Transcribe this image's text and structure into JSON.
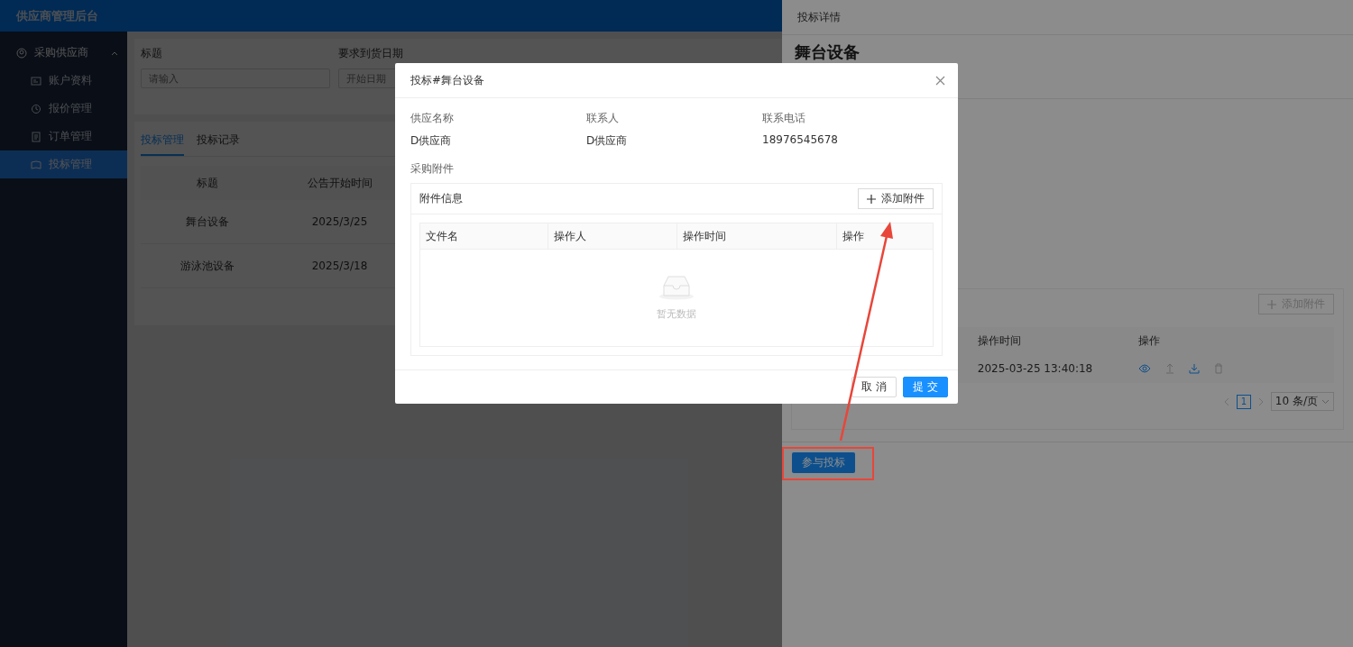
{
  "app": {
    "title": "供应商管理后台"
  },
  "sidebar": {
    "items": [
      {
        "label": "采购供应商",
        "expanded": true,
        "children": [
          {
            "label": "账户资料",
            "selected": false
          },
          {
            "label": "报价管理",
            "selected": false
          },
          {
            "label": "订单管理",
            "selected": false
          },
          {
            "label": "投标管理",
            "selected": true
          }
        ]
      }
    ]
  },
  "filters": [
    {
      "label": "标题",
      "placeholder": "请输入"
    },
    {
      "label": "要求到货日期",
      "placeholder": "开始日期"
    }
  ],
  "tabs": [
    {
      "label": "投标管理",
      "selected": true
    },
    {
      "label": "投标记录",
      "selected": false
    }
  ],
  "table": {
    "columns": [
      "标题",
      "公告开始时间"
    ],
    "rows": [
      [
        "舞台设备",
        "2025/3/25"
      ],
      [
        "游泳池设备",
        "2025/3/18"
      ]
    ]
  },
  "drawer": {
    "title": "投标详情",
    "heading": "舞台设备",
    "add_button": "添加附件",
    "columns": [
      "操作时间",
      "操作"
    ],
    "rows": [
      {
        "time": "2025-03-25 13:40:18"
      }
    ],
    "pagination": {
      "pages": [
        {
          "label": "1",
          "selected": true
        }
      ],
      "page_size": "10 条/页"
    },
    "submit": "参与投标"
  },
  "modal": {
    "title": "投标#舞台设备",
    "fields": [
      {
        "label": "供应名称",
        "value": "D供应商"
      },
      {
        "label": "联系人",
        "value": "D供应商"
      },
      {
        "label": "联系电话",
        "value": "18976545678"
      }
    ],
    "section": "采购附件",
    "card_title": "附件信息",
    "add_button": "添加附件",
    "columns": [
      "文件名",
      "操作人",
      "操作时间",
      "操作"
    ],
    "empty": "暂无数据",
    "buttons": [
      {
        "label": "取 消",
        "kind": "default"
      },
      {
        "label": "提 交",
        "kind": "primary"
      }
    ]
  }
}
